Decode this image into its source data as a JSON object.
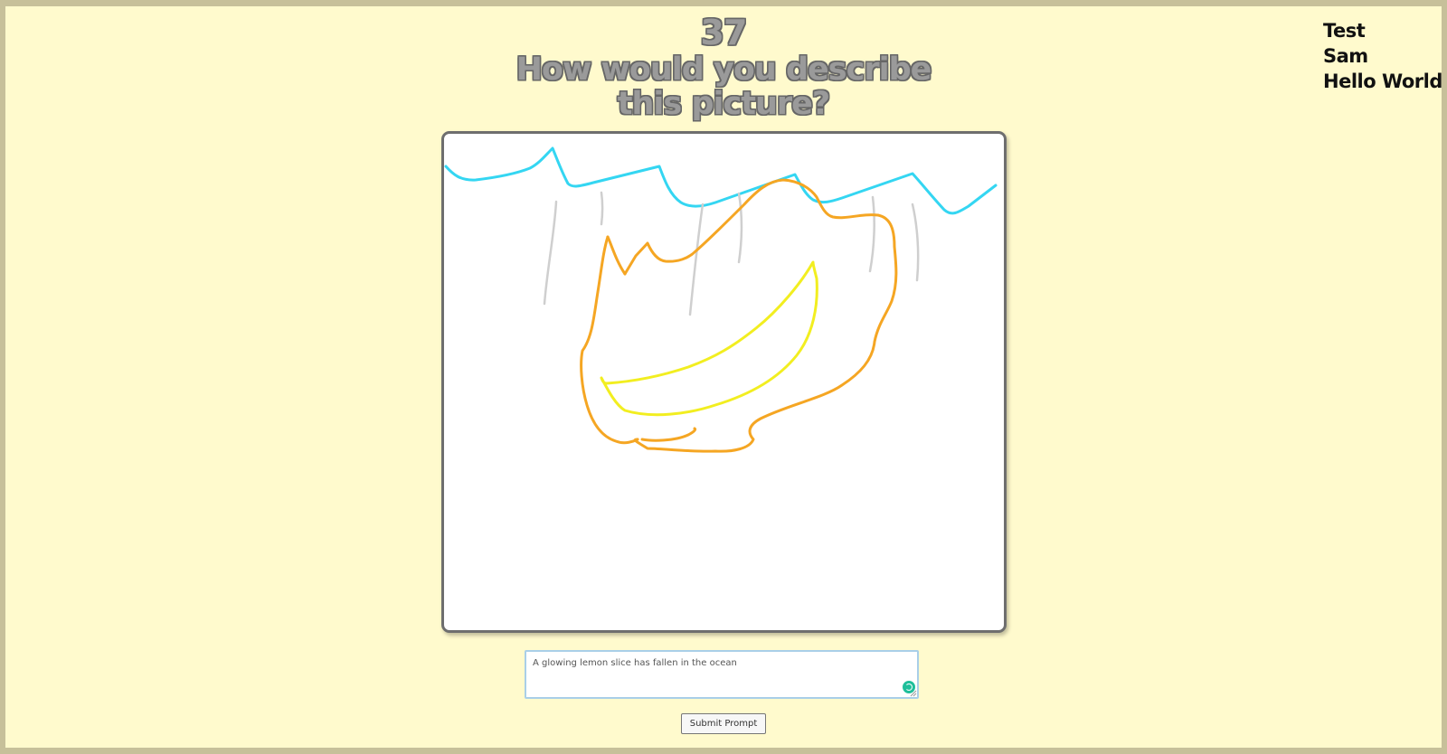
{
  "game": {
    "timer": "37",
    "question_line1": "How would you describe",
    "question_line2": "this picture?"
  },
  "players": [
    "Test",
    "Sam",
    "Hello World"
  ],
  "drawing": {
    "colors": {
      "water": "#34d6f2",
      "rain": "#cfcfcf",
      "peel": "#f5a623",
      "slice": "#f2ee20"
    }
  },
  "prompt": {
    "value": "A glowing lemon slice has fallen in the ocean",
    "placeholder": ""
  },
  "submit": {
    "label": "Submit Prompt"
  },
  "icons": {
    "assist": "grammar-assist-icon"
  }
}
